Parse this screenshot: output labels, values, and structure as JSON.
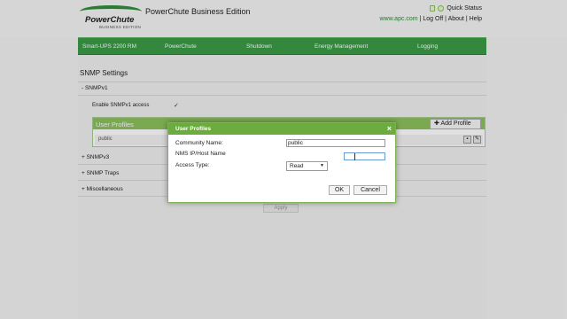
{
  "header": {
    "logo_text": "PowerChute",
    "logo_sub": "BUSINESS EDITION",
    "app_title": "PowerChute Business Edition",
    "quick_status": "Quick Status",
    "url": "www.apc.com",
    "logoff": "Log Off",
    "about": "About",
    "help": "Help",
    "sep": "|"
  },
  "nav": {
    "items": [
      "Smart-UPS 2200 RM",
      "PowerChute",
      "Shutdown",
      "Energy Management",
      "Logging"
    ]
  },
  "page": {
    "title": "SNMP Settings",
    "snmpv1_header": "- SNMPv1",
    "enable_label": "Enable SNMPv1 access",
    "enable_checked": "✓",
    "profiles_title": "User Profiles",
    "add_profile": "Add Profile",
    "profile_row": "public",
    "snmpv3_header": "+ SNMPv3",
    "traps_header": "+ SNMP Traps",
    "misc_header": "+ Miscellaneous",
    "apply": "Apply"
  },
  "dialog": {
    "title": "User Profiles",
    "close": "×",
    "community_label": "Community Name:",
    "community_value": "public",
    "nms_label": "NMS IP/Host Name",
    "nms_value": "",
    "access_label": "Access Type:",
    "access_value": "Read",
    "ok": "OK",
    "cancel": "Cancel"
  },
  "colors": {
    "nav_green": "#3c9b46",
    "dialog_header": "#6cac3f",
    "profiles_header": "#8cc15e"
  }
}
